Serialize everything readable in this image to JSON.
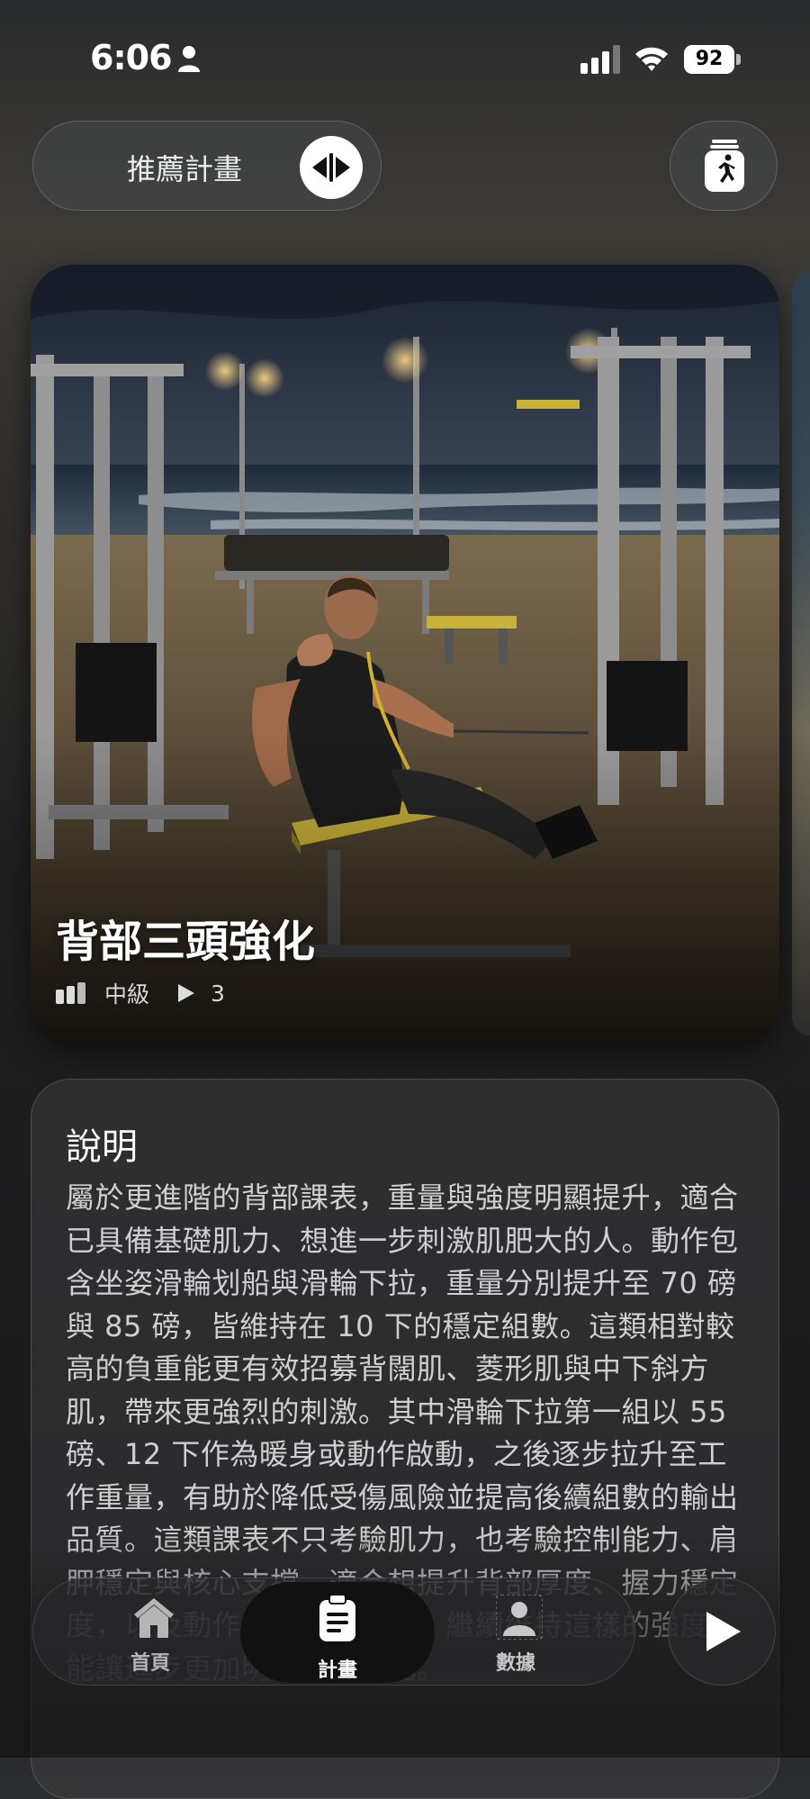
{
  "status_bar": {
    "time": "6:06",
    "battery": "92"
  },
  "header": {
    "plan_label": "推薦計畫",
    "swap_icon": "swap-arrows-icon",
    "runner_icon": "running-app-icon"
  },
  "hero": {
    "title": "背部三頭強化",
    "level": "中級",
    "count": "3"
  },
  "description": {
    "heading": "說明",
    "body": "屬於更進階的背部課表，重量與強度明顯提升，適合已具備基礎肌力、想進一步刺激肌肥大的人。動作包含坐姿滑輪划船與滑輪下拉，重量分別提升至 70 磅與 85 磅，皆維持在 10 下的穩定組數。這類相對較高的負重能更有效招募背闊肌、菱形肌與中下斜方肌，帶來更強烈的刺激。其中滑輪下拉第一組以 55 磅、12 下作為暖身或動作啟動，之後逐步拉升至工作重量，有助於降低受傷風險並提高後續組數的輸出品質。這類課表不只考驗肌力，也考驗控制能力、肩胛穩定與核心支撐，適合想提升背部厚度、握力穩定度，以及動作的力量耐受度。繼續維持這樣的強度，能讓進步更加明顯且可量化。"
  },
  "tabbar": {
    "tabs": [
      {
        "label": "首頁",
        "icon": "home-icon"
      },
      {
        "label": "計畫",
        "icon": "clipboard-icon"
      },
      {
        "label": "數據",
        "icon": "stats-person-icon"
      }
    ],
    "active": "計畫",
    "play_icon": "play-icon"
  },
  "colors": {
    "accent": "#ffffff",
    "background": "#1c1c1d"
  }
}
